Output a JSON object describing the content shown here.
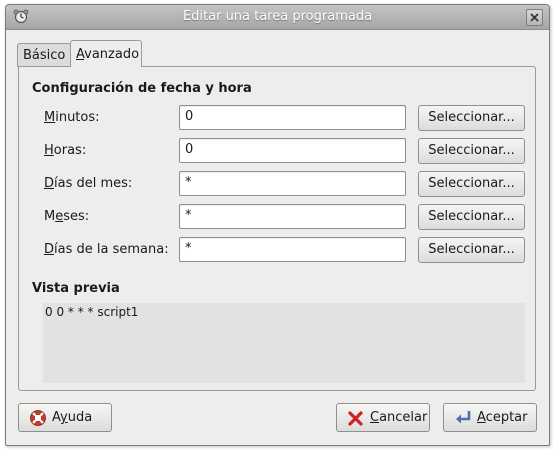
{
  "window": {
    "title": "Editar una tarea programada",
    "app_icon": "scheduler-icon",
    "close_icon": "close-icon"
  },
  "tabs": [
    {
      "label": "Básico",
      "active": false
    },
    {
      "label_mnemonic": "A",
      "label_rest": "vanzado",
      "active": true
    }
  ],
  "datetime_section": {
    "title": "Configuración de fecha y hora",
    "fields": [
      {
        "mn": "M",
        "rest": "inutos:",
        "value": "0",
        "button": "Seleccionar..."
      },
      {
        "mn": "H",
        "rest": "oras:",
        "value": "0",
        "button": "Seleccionar..."
      },
      {
        "mn": "D",
        "rest": "ías del mes:",
        "value": "*",
        "button": "Seleccionar..."
      },
      {
        "pre": "M",
        "mn": "e",
        "rest": "ses:",
        "value": "*",
        "button": "Seleccionar..."
      },
      {
        "mn": "D",
        "rest": "ías de la semana:",
        "value": "*",
        "button": "Seleccionar..."
      }
    ]
  },
  "preview": {
    "title": "Vista previa",
    "text": "0 0 * * * script1"
  },
  "buttons": {
    "help": {
      "pre": "A",
      "mn": "y",
      "rest": "uda",
      "icon": "help-lifebuoy-icon"
    },
    "cancel": {
      "mn": "C",
      "rest": "ancelar",
      "icon": "cancel-x-icon",
      "icon_color": "#cc2222"
    },
    "accept": {
      "mn": "A",
      "rest": "ceptar",
      "icon": "accept-arrow-icon",
      "icon_color": "#4a72b0"
    }
  }
}
